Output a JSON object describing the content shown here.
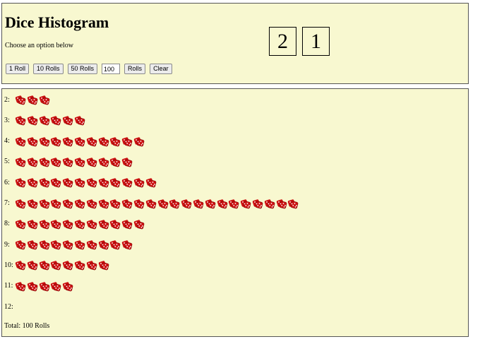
{
  "header": {
    "title": "Dice Histogram",
    "subtitle": "Choose an option below"
  },
  "controls": {
    "one_roll_label": "1 Roll",
    "ten_rolls_label": "10 Rolls",
    "fifty_rolls_label": "50 Rolls",
    "custom_count_value": "100",
    "rolls_label": "Rolls",
    "clear_label": "Clear"
  },
  "dice": {
    "die1_value": "2",
    "die2_value": "1"
  },
  "histogram": {
    "rows": [
      {
        "label": "2:",
        "count": 3
      },
      {
        "label": "3:",
        "count": 6
      },
      {
        "label": "4:",
        "count": 11
      },
      {
        "label": "5:",
        "count": 10
      },
      {
        "label": "6:",
        "count": 12
      },
      {
        "label": "7:",
        "count": 24
      },
      {
        "label": "8:",
        "count": 11
      },
      {
        "label": "9:",
        "count": 10
      },
      {
        "label": "10:",
        "count": 8
      },
      {
        "label": "11:",
        "count": 5
      },
      {
        "label": "12:",
        "count": 0
      }
    ],
    "icon": "red-dice-icon",
    "icon_color": "#cc1111"
  },
  "footer": {
    "total_text": "Total: 100 Rolls"
  }
}
